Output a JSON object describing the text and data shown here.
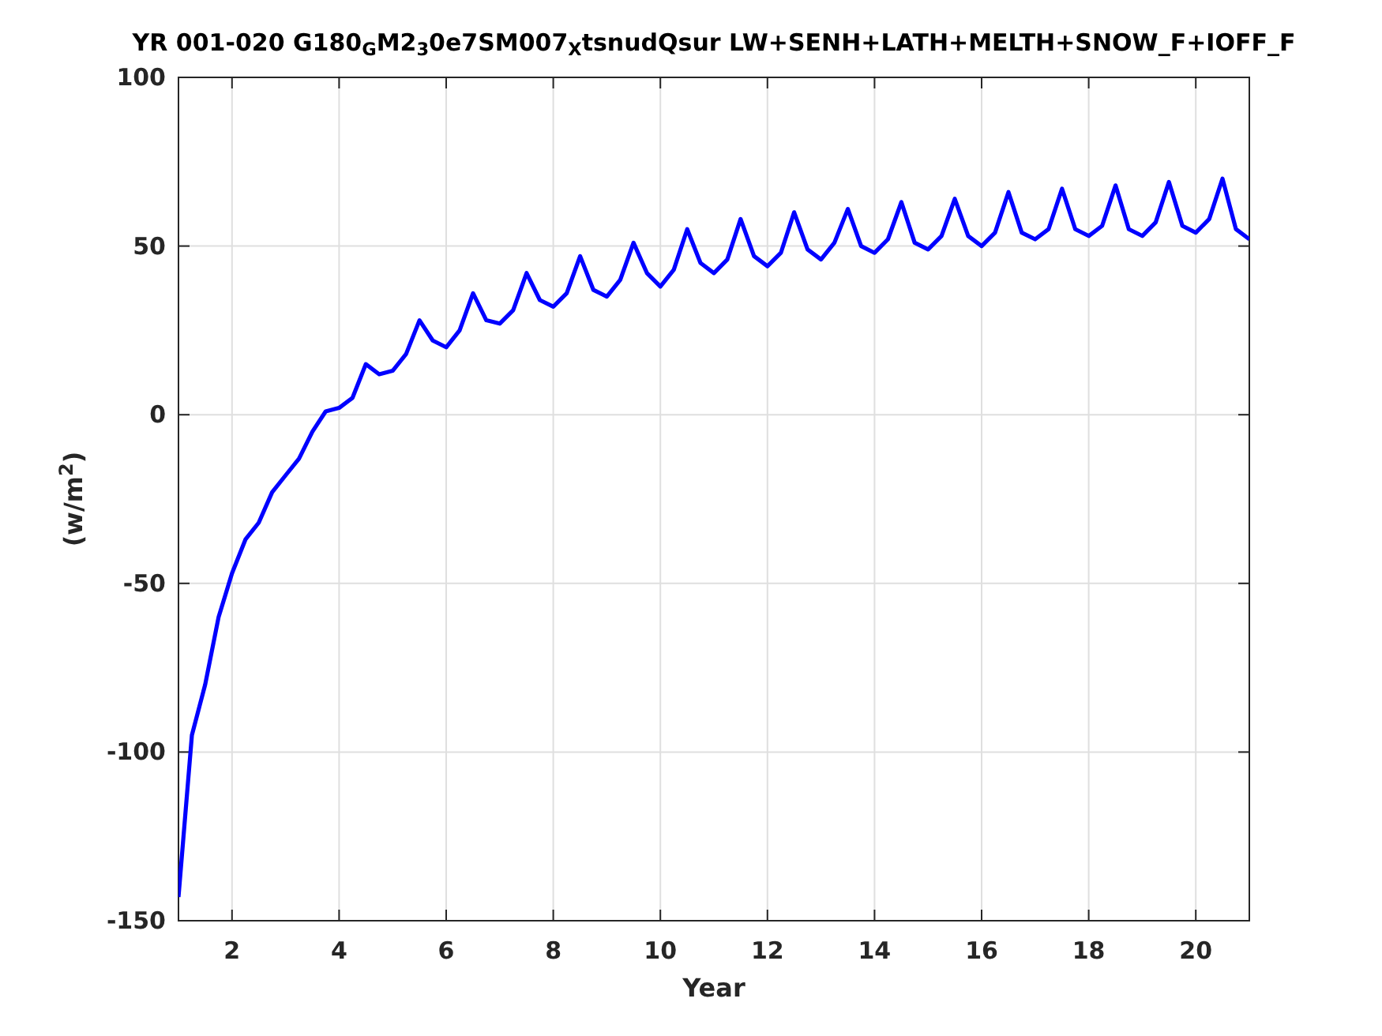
{
  "figure": {
    "title": "YR 001-020 G180$_{G}$M2$_{3}$0e7SM007$_{X}$tsnudQsur LW+SENH+LATH+MELTH+SNOW_F+IOFF_F",
    "chart_data": {
      "type": "line",
      "xlabel": "Year",
      "ylabel": "(w/m$^{2}$)",
      "grid": true,
      "xlim": [
        1,
        21
      ],
      "ylim": [
        -150,
        100
      ],
      "xticks": [
        2,
        4,
        6,
        8,
        10,
        12,
        14,
        16,
        18,
        20
      ],
      "yticks": [
        -150,
        -100,
        -50,
        0,
        50,
        100
      ],
      "x": [
        1,
        1.25,
        1.5,
        1.75,
        2,
        2.25,
        2.5,
        2.75,
        3,
        3.25,
        3.5,
        3.75,
        4,
        4.25,
        4.5,
        4.75,
        5,
        5.25,
        5.5,
        5.75,
        6,
        6.25,
        6.5,
        6.75,
        7,
        7.25,
        7.5,
        7.75,
        8,
        8.25,
        8.5,
        8.75,
        9,
        9.25,
        9.5,
        9.75,
        10,
        10.25,
        10.5,
        10.75,
        11,
        11.25,
        11.5,
        11.75,
        12,
        12.25,
        12.5,
        12.75,
        13,
        13.25,
        13.5,
        13.75,
        14,
        14.25,
        14.5,
        14.75,
        15,
        15.25,
        15.5,
        15.75,
        16,
        16.25,
        16.5,
        16.75,
        17,
        17.25,
        17.5,
        17.75,
        18,
        18.25,
        18.5,
        18.75,
        19,
        19.25,
        19.5,
        19.75,
        20,
        20.25,
        20.5,
        20.75,
        21
      ],
      "series": [
        {
          "color": "#0000ff",
          "values": [
            -143,
            -95,
            -80,
            -60,
            -47,
            -37,
            -32,
            -23,
            -18,
            -13,
            -5,
            1,
            2,
            5,
            15,
            12,
            13,
            18,
            28,
            22,
            20,
            25,
            36,
            28,
            27,
            31,
            42,
            34,
            32,
            36,
            47,
            37,
            35,
            40,
            51,
            42,
            38,
            43,
            55,
            45,
            42,
            46,
            58,
            47,
            44,
            48,
            60,
            49,
            46,
            51,
            61,
            50,
            48,
            52,
            63,
            51,
            49,
            53,
            64,
            53,
            50,
            54,
            66,
            54,
            52,
            55,
            67,
            55,
            53,
            56,
            68,
            55,
            53,
            57,
            69,
            56,
            54,
            58,
            70,
            55,
            52
          ]
        }
      ]
    }
  }
}
